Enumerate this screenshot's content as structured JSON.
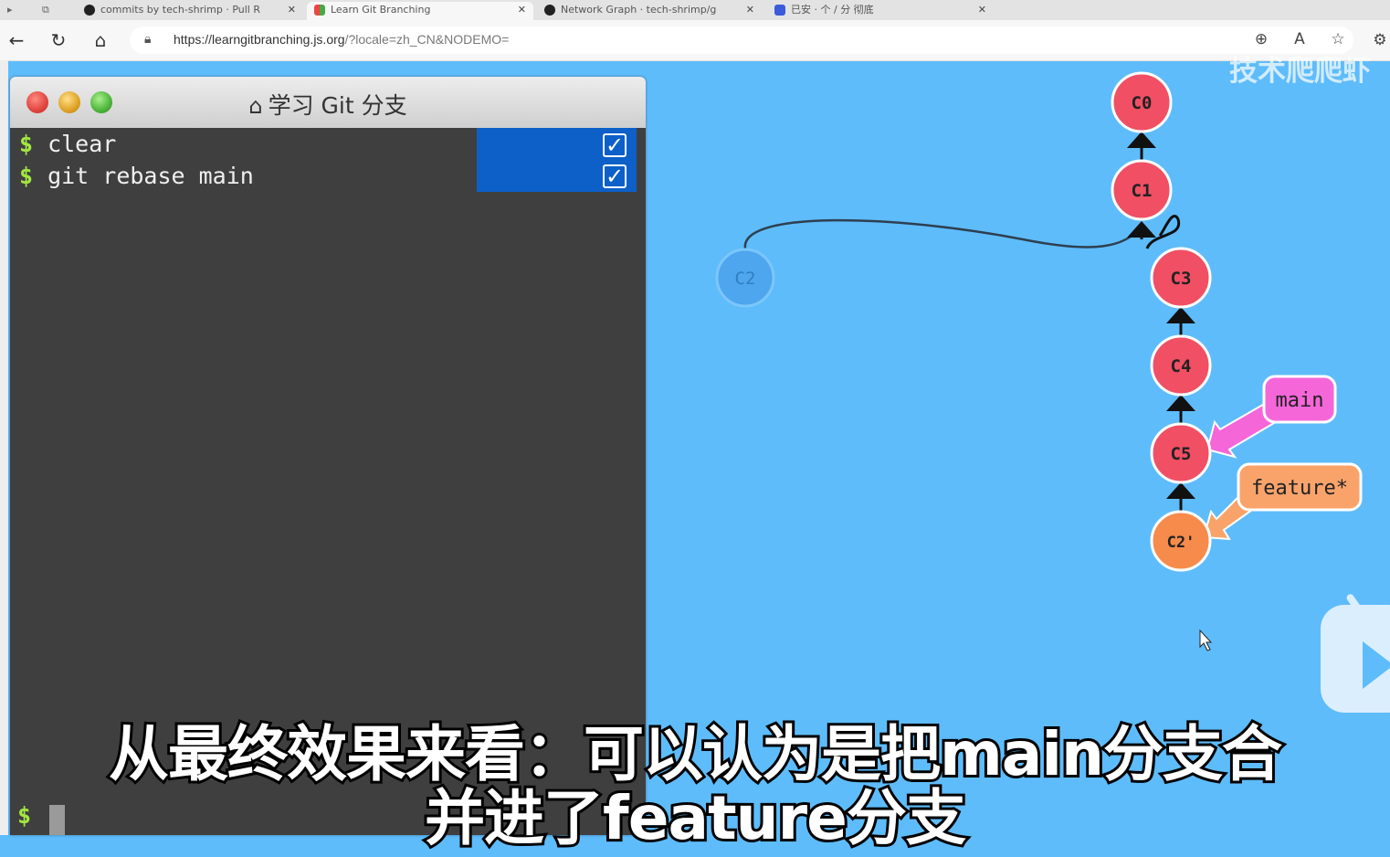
{
  "browser": {
    "tabs": [
      {
        "label": "commits by tech-shrimp · Pull R",
        "active": false,
        "close": "✕"
      },
      {
        "label": "Learn Git Branching",
        "active": true,
        "close": "✕"
      },
      {
        "label": "Network Graph · tech-shrimp/g",
        "active": false,
        "close": "✕"
      },
      {
        "label": "已安 · 个 / 分 彻底",
        "active": false,
        "close": "✕"
      }
    ],
    "url_base": "https://learngitbranching.js.org",
    "url_rest": "/?locale=zh_CN&NODEMO="
  },
  "terminal": {
    "title": "学习 Git 分支",
    "commands": [
      {
        "prompt": "$",
        "text": "clear"
      },
      {
        "prompt": "$",
        "text": "git rebase main"
      }
    ],
    "prompt": "$"
  },
  "graph": {
    "commits": [
      {
        "id": "C0",
        "label": "C0",
        "color": "#f14f64"
      },
      {
        "id": "C1",
        "label": "C1",
        "color": "#f14f64"
      },
      {
        "id": "C2",
        "label": "C2",
        "color": "#4ea6ee"
      },
      {
        "id": "C3",
        "label": "C3",
        "color": "#f14f64"
      },
      {
        "id": "C4",
        "label": "C4",
        "color": "#f14f64"
      },
      {
        "id": "C5",
        "label": "C5",
        "color": "#f14f64"
      },
      {
        "id": "C2p",
        "label": "C2'",
        "color": "#f78b4b"
      }
    ],
    "branches": [
      {
        "name": "main",
        "color": "#f566d9",
        "target": "C5"
      },
      {
        "name": "feature*",
        "color": "#f9a36b",
        "target": "C2'"
      }
    ]
  },
  "watermark": "技术爬爬虾",
  "subtitle": {
    "line1": "从最终效果来看：可以认为是把main分支合",
    "line2": "并进了feature分支"
  }
}
